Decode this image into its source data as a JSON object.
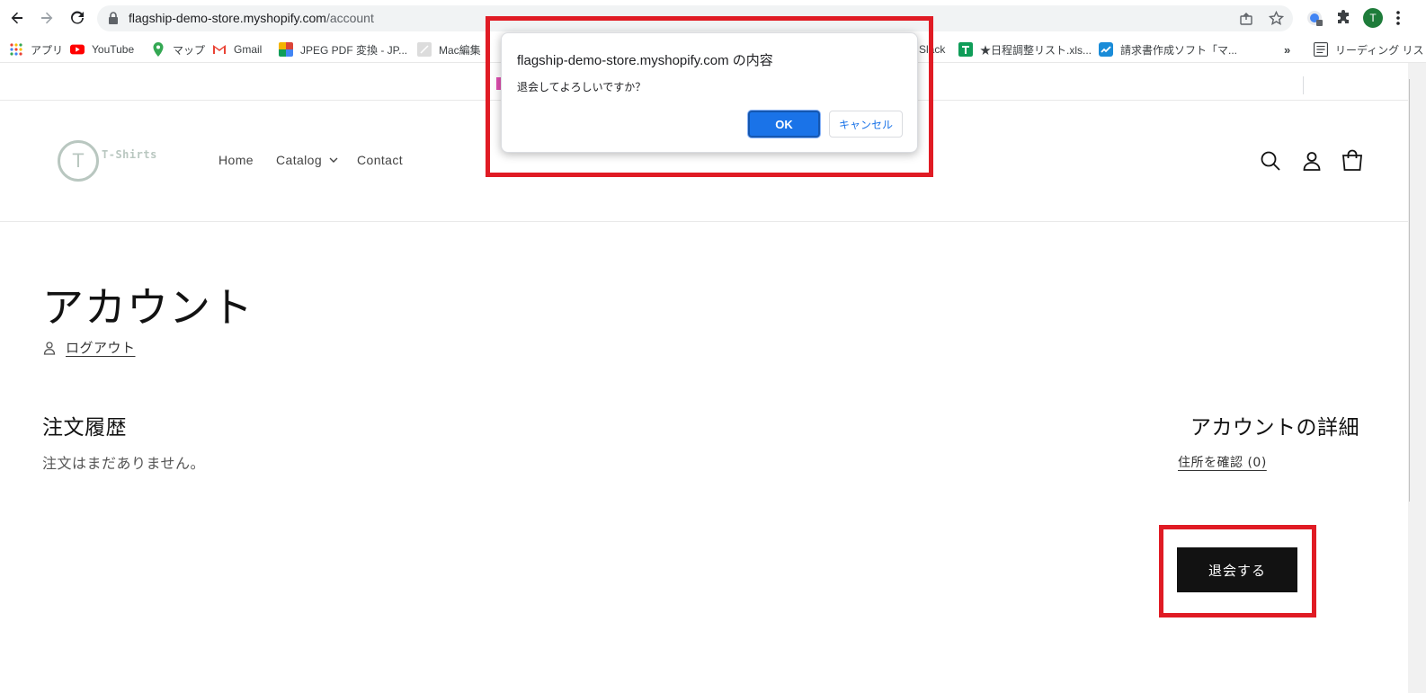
{
  "browser": {
    "url_host": "flagship-demo-store.myshopify.com",
    "url_path": "/account",
    "avatar_letter": "T",
    "bookmarks": [
      {
        "label": "アプリ"
      },
      {
        "label": "YouTube"
      },
      {
        "label": "マップ"
      },
      {
        "label": "Gmail"
      },
      {
        "label": "JPEG PDF 変換 - JP..."
      },
      {
        "label": "Mac編集"
      },
      {
        "label": "Slack"
      },
      {
        "label": "★日程調整リスト.xls..."
      },
      {
        "label": "請求書作成ソフト「マ..."
      }
    ],
    "overflow": "»",
    "reading_list": "リーディング リスト"
  },
  "store": {
    "logo_letter": "T",
    "logo_text": "T-Shirts",
    "nav": {
      "home": "Home",
      "catalog": "Catalog",
      "contact": "Contact"
    }
  },
  "account": {
    "title": "アカウント",
    "logout": "ログアウト",
    "orders_title": "注文履歴",
    "orders_empty": "注文はまだありません。",
    "details_title": "アカウントの詳細",
    "address_link": "住所を確認 (0)",
    "withdraw_button": "退会する"
  },
  "dialog": {
    "title": "flagship-demo-store.myshopify.com の内容",
    "message": "退会してよろしいですか？",
    "ok": "OK",
    "cancel": "キャンセル"
  },
  "colors": {
    "highlight": "#e01b24",
    "primary_button": "#121212",
    "dialog_ok": "#1a73e8"
  }
}
